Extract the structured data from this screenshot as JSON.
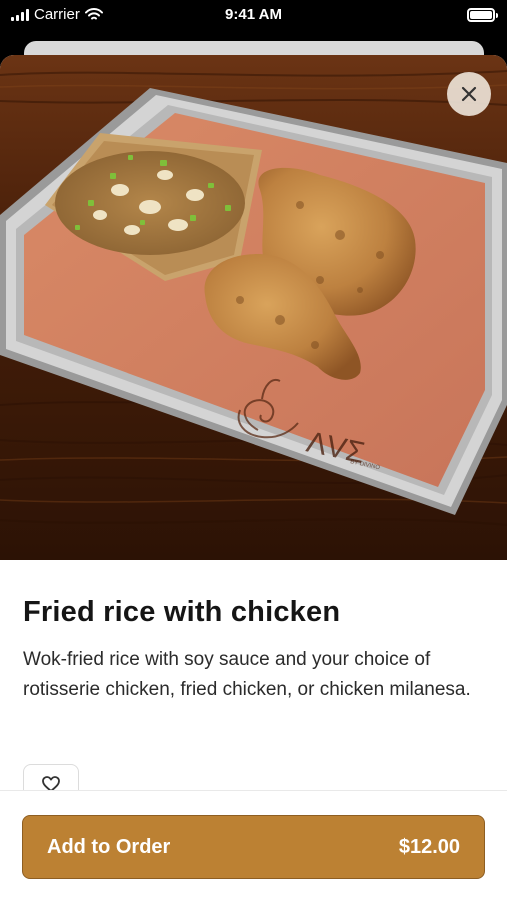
{
  "status_bar": {
    "carrier": "Carrier",
    "time": "9:41 AM"
  },
  "product": {
    "title": "Fried rice with chicken",
    "description": "Wok-fried rice with soy sauce and your choice of rotisserie chicken, fried chicken, or chicken milanesa.",
    "photo_mark": "ΛVΣ",
    "photo_mark_sub": "BY DIVINO"
  },
  "order_button": {
    "label": "Add to Order",
    "price": "$12.00"
  },
  "colors": {
    "accent": "#bc8133",
    "accent_border": "#8e5e22",
    "title_text": "#151515",
    "body_text": "#2b2b2b"
  },
  "icons": {
    "close": "close-icon",
    "favorite": "heart-icon",
    "signal": "signal-icon",
    "wifi": "wifi-icon",
    "battery": "battery-icon"
  }
}
